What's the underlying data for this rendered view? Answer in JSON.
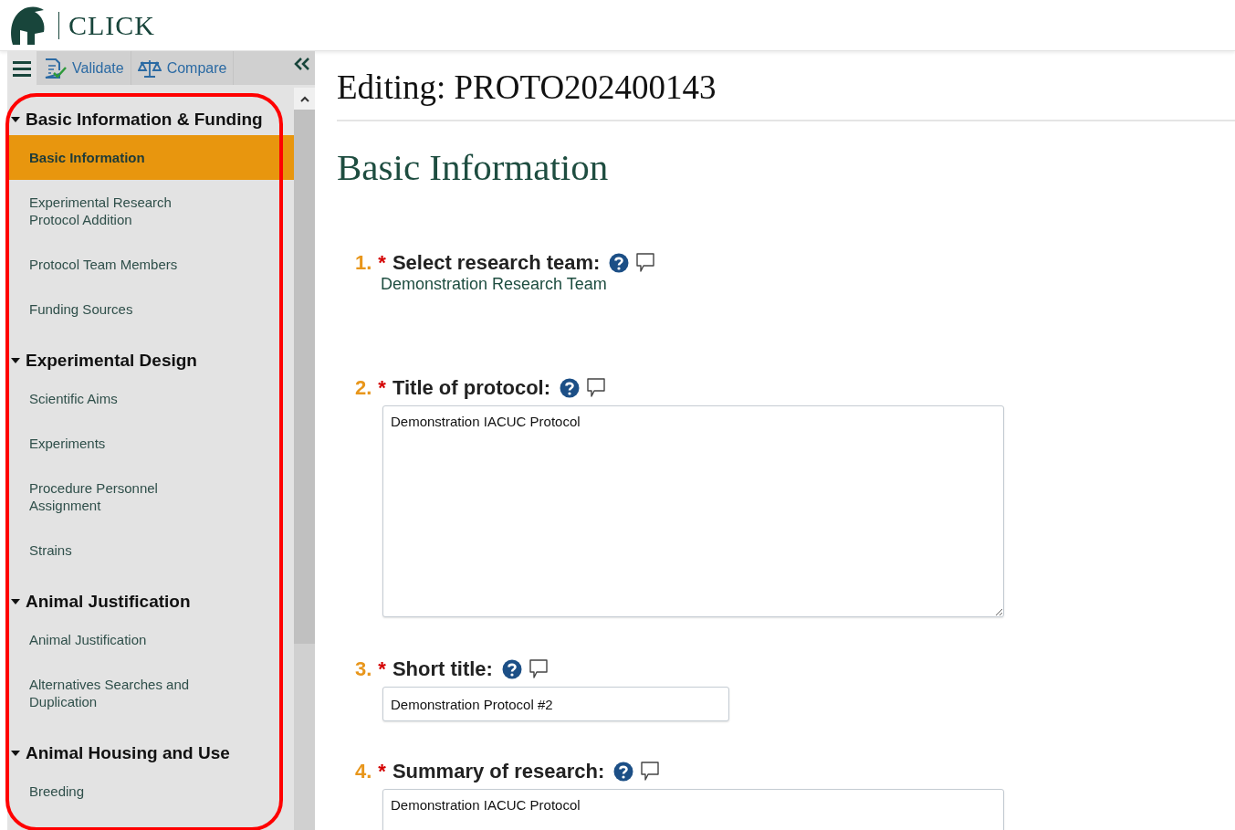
{
  "header": {
    "logo_text": "CLICK"
  },
  "toolbar": {
    "buttons": [
      {
        "kind": "validate",
        "label": "Validate"
      },
      {
        "kind": "compare",
        "label": "Compare"
      }
    ]
  },
  "sidebar": {
    "sections": [
      {
        "title": "Basic Information & Funding",
        "expanded": true,
        "items": [
          {
            "label": "Basic Information",
            "selected": true
          },
          {
            "label": "Experimental Research Protocol Addition",
            "selected": false
          },
          {
            "label": "Protocol Team Members",
            "selected": false
          },
          {
            "label": "Funding Sources",
            "selected": false
          }
        ]
      },
      {
        "title": "Experimental Design",
        "expanded": true,
        "items": [
          {
            "label": "Scientific Aims",
            "selected": false
          },
          {
            "label": "Experiments",
            "selected": false
          },
          {
            "label": "Procedure Personnel Assignment",
            "selected": false
          },
          {
            "label": "Strains",
            "selected": false
          }
        ]
      },
      {
        "title": "Animal Justification",
        "expanded": true,
        "items": [
          {
            "label": "Animal Justification",
            "selected": false
          },
          {
            "label": "Alternatives Searches and Duplication",
            "selected": false
          }
        ]
      },
      {
        "title": "Animal Housing and Use",
        "expanded": true,
        "items": [
          {
            "label": "Breeding",
            "selected": false
          }
        ]
      }
    ]
  },
  "page": {
    "title": "Editing: PROTO202400143",
    "section_title": "Basic Information"
  },
  "questions": [
    {
      "number": "1.",
      "required_mark": "*",
      "label": "Select research team:",
      "kind": "text",
      "value": "Demonstration Research Team"
    },
    {
      "number": "2.",
      "required_mark": "*",
      "label": "Title of protocol:",
      "kind": "textarea",
      "value": "Demonstration IACUC Protocol"
    },
    {
      "number": "3.",
      "required_mark": "*",
      "label": "Short title:",
      "kind": "input",
      "value": "Demonstration Protocol #2"
    },
    {
      "number": "4.",
      "required_mark": "*",
      "label": "Summary of research:",
      "kind": "textarea-cut",
      "value": "Demonstration IACUC Protocol"
    }
  ]
}
